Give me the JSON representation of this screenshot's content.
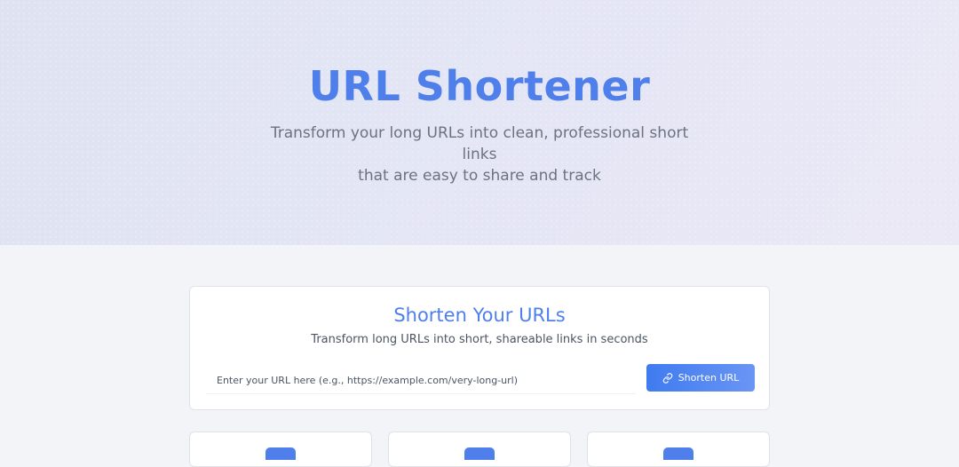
{
  "hero": {
    "title": "URL Shortener",
    "subtitle_line1": "Transform your long URLs into clean, professional short links",
    "subtitle_line2": "that are easy to share and track"
  },
  "shortener": {
    "title": "Shorten Your URLs",
    "subtitle": "Transform long URLs into short, shareable links in seconds",
    "input_value": "",
    "input_placeholder": "Enter your URL here (e.g., https://example.com/very-long-url)",
    "button_label": "Shorten URL",
    "button_icon": "link-icon"
  },
  "features": [
    {
      "icon": "feature-icon"
    },
    {
      "icon": "feature-icon"
    },
    {
      "icon": "feature-icon"
    }
  ],
  "colors": {
    "accent": "#4f7fea",
    "button_start": "#3f7bf0",
    "button_end": "#6a95f4",
    "page_bg": "#f3f4f8"
  }
}
